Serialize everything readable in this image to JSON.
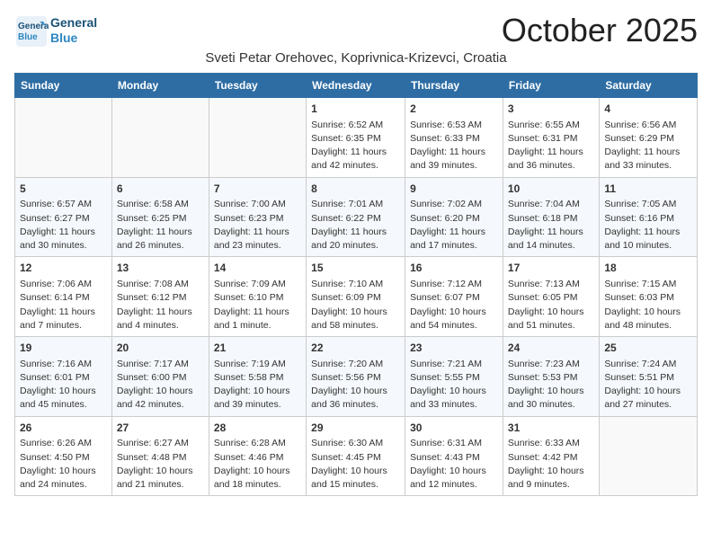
{
  "header": {
    "logo_line1": "General",
    "logo_line2": "Blue",
    "month": "October 2025",
    "location": "Sveti Petar Orehovec, Koprivnica-Krizevci, Croatia"
  },
  "weekdays": [
    "Sunday",
    "Monday",
    "Tuesday",
    "Wednesday",
    "Thursday",
    "Friday",
    "Saturday"
  ],
  "weeks": [
    [
      {
        "day": "",
        "content": ""
      },
      {
        "day": "",
        "content": ""
      },
      {
        "day": "",
        "content": ""
      },
      {
        "day": "1",
        "content": "Sunrise: 6:52 AM\nSunset: 6:35 PM\nDaylight: 11 hours\nand 42 minutes."
      },
      {
        "day": "2",
        "content": "Sunrise: 6:53 AM\nSunset: 6:33 PM\nDaylight: 11 hours\nand 39 minutes."
      },
      {
        "day": "3",
        "content": "Sunrise: 6:55 AM\nSunset: 6:31 PM\nDaylight: 11 hours\nand 36 minutes."
      },
      {
        "day": "4",
        "content": "Sunrise: 6:56 AM\nSunset: 6:29 PM\nDaylight: 11 hours\nand 33 minutes."
      }
    ],
    [
      {
        "day": "5",
        "content": "Sunrise: 6:57 AM\nSunset: 6:27 PM\nDaylight: 11 hours\nand 30 minutes."
      },
      {
        "day": "6",
        "content": "Sunrise: 6:58 AM\nSunset: 6:25 PM\nDaylight: 11 hours\nand 26 minutes."
      },
      {
        "day": "7",
        "content": "Sunrise: 7:00 AM\nSunset: 6:23 PM\nDaylight: 11 hours\nand 23 minutes."
      },
      {
        "day": "8",
        "content": "Sunrise: 7:01 AM\nSunset: 6:22 PM\nDaylight: 11 hours\nand 20 minutes."
      },
      {
        "day": "9",
        "content": "Sunrise: 7:02 AM\nSunset: 6:20 PM\nDaylight: 11 hours\nand 17 minutes."
      },
      {
        "day": "10",
        "content": "Sunrise: 7:04 AM\nSunset: 6:18 PM\nDaylight: 11 hours\nand 14 minutes."
      },
      {
        "day": "11",
        "content": "Sunrise: 7:05 AM\nSunset: 6:16 PM\nDaylight: 11 hours\nand 10 minutes."
      }
    ],
    [
      {
        "day": "12",
        "content": "Sunrise: 7:06 AM\nSunset: 6:14 PM\nDaylight: 11 hours\nand 7 minutes."
      },
      {
        "day": "13",
        "content": "Sunrise: 7:08 AM\nSunset: 6:12 PM\nDaylight: 11 hours\nand 4 minutes."
      },
      {
        "day": "14",
        "content": "Sunrise: 7:09 AM\nSunset: 6:10 PM\nDaylight: 11 hours\nand 1 minute."
      },
      {
        "day": "15",
        "content": "Sunrise: 7:10 AM\nSunset: 6:09 PM\nDaylight: 10 hours\nand 58 minutes."
      },
      {
        "day": "16",
        "content": "Sunrise: 7:12 AM\nSunset: 6:07 PM\nDaylight: 10 hours\nand 54 minutes."
      },
      {
        "day": "17",
        "content": "Sunrise: 7:13 AM\nSunset: 6:05 PM\nDaylight: 10 hours\nand 51 minutes."
      },
      {
        "day": "18",
        "content": "Sunrise: 7:15 AM\nSunset: 6:03 PM\nDaylight: 10 hours\nand 48 minutes."
      }
    ],
    [
      {
        "day": "19",
        "content": "Sunrise: 7:16 AM\nSunset: 6:01 PM\nDaylight: 10 hours\nand 45 minutes."
      },
      {
        "day": "20",
        "content": "Sunrise: 7:17 AM\nSunset: 6:00 PM\nDaylight: 10 hours\nand 42 minutes."
      },
      {
        "day": "21",
        "content": "Sunrise: 7:19 AM\nSunset: 5:58 PM\nDaylight: 10 hours\nand 39 minutes."
      },
      {
        "day": "22",
        "content": "Sunrise: 7:20 AM\nSunset: 5:56 PM\nDaylight: 10 hours\nand 36 minutes."
      },
      {
        "day": "23",
        "content": "Sunrise: 7:21 AM\nSunset: 5:55 PM\nDaylight: 10 hours\nand 33 minutes."
      },
      {
        "day": "24",
        "content": "Sunrise: 7:23 AM\nSunset: 5:53 PM\nDaylight: 10 hours\nand 30 minutes."
      },
      {
        "day": "25",
        "content": "Sunrise: 7:24 AM\nSunset: 5:51 PM\nDaylight: 10 hours\nand 27 minutes."
      }
    ],
    [
      {
        "day": "26",
        "content": "Sunrise: 6:26 AM\nSunset: 4:50 PM\nDaylight: 10 hours\nand 24 minutes."
      },
      {
        "day": "27",
        "content": "Sunrise: 6:27 AM\nSunset: 4:48 PM\nDaylight: 10 hours\nand 21 minutes."
      },
      {
        "day": "28",
        "content": "Sunrise: 6:28 AM\nSunset: 4:46 PM\nDaylight: 10 hours\nand 18 minutes."
      },
      {
        "day": "29",
        "content": "Sunrise: 6:30 AM\nSunset: 4:45 PM\nDaylight: 10 hours\nand 15 minutes."
      },
      {
        "day": "30",
        "content": "Sunrise: 6:31 AM\nSunset: 4:43 PM\nDaylight: 10 hours\nand 12 minutes."
      },
      {
        "day": "31",
        "content": "Sunrise: 6:33 AM\nSunset: 4:42 PM\nDaylight: 10 hours\nand 9 minutes."
      },
      {
        "day": "",
        "content": ""
      }
    ]
  ]
}
